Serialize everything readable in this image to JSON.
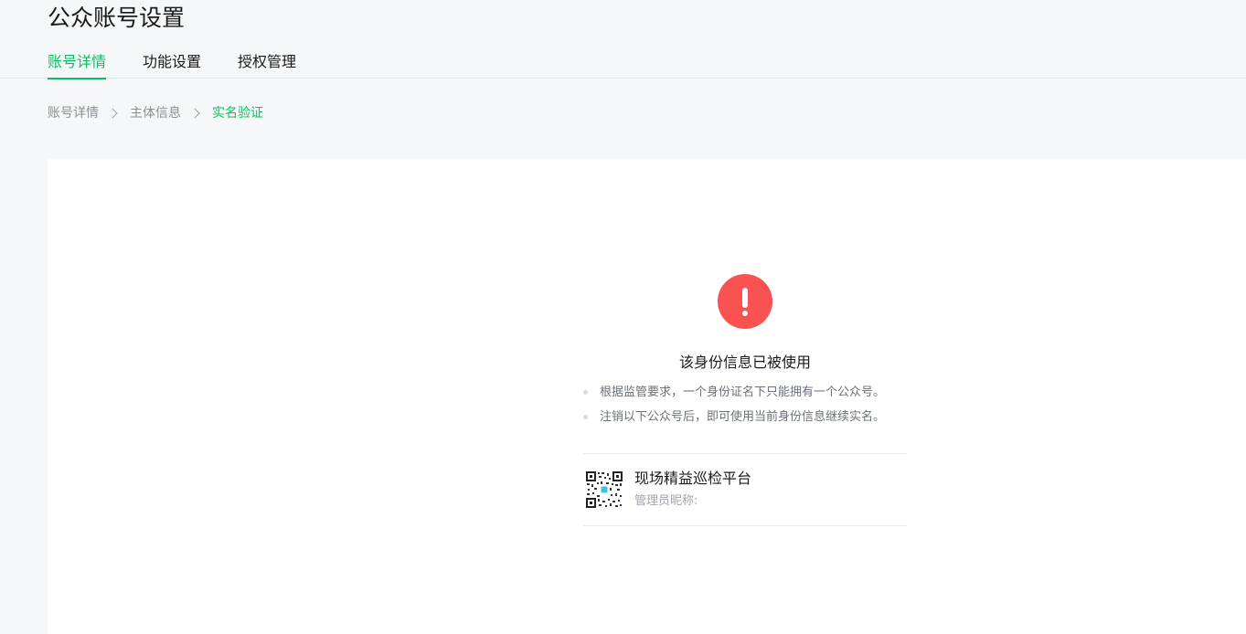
{
  "header": {
    "title": "公众账号设置"
  },
  "tabs": [
    {
      "label": "账号详情",
      "active": true
    },
    {
      "label": "功能设置",
      "active": false
    },
    {
      "label": "授权管理",
      "active": false
    }
  ],
  "breadcrumb": [
    "账号详情",
    "主体信息",
    "实名验证"
  ],
  "result": {
    "icon": "exclamation-icon",
    "title": "该身份信息已被使用",
    "tips": [
      "根据监管要求，一个身份证名下只能拥有一个公众号。",
      "注销以下公众号后，即可使用当前身份信息继续实名。"
    ]
  },
  "account": {
    "icon": "qr-code-icon",
    "name": "现场精益巡检平台",
    "admin_label": "管理员昵称:"
  },
  "colors": {
    "accent": "#07c160",
    "warning": "#fa5151"
  }
}
